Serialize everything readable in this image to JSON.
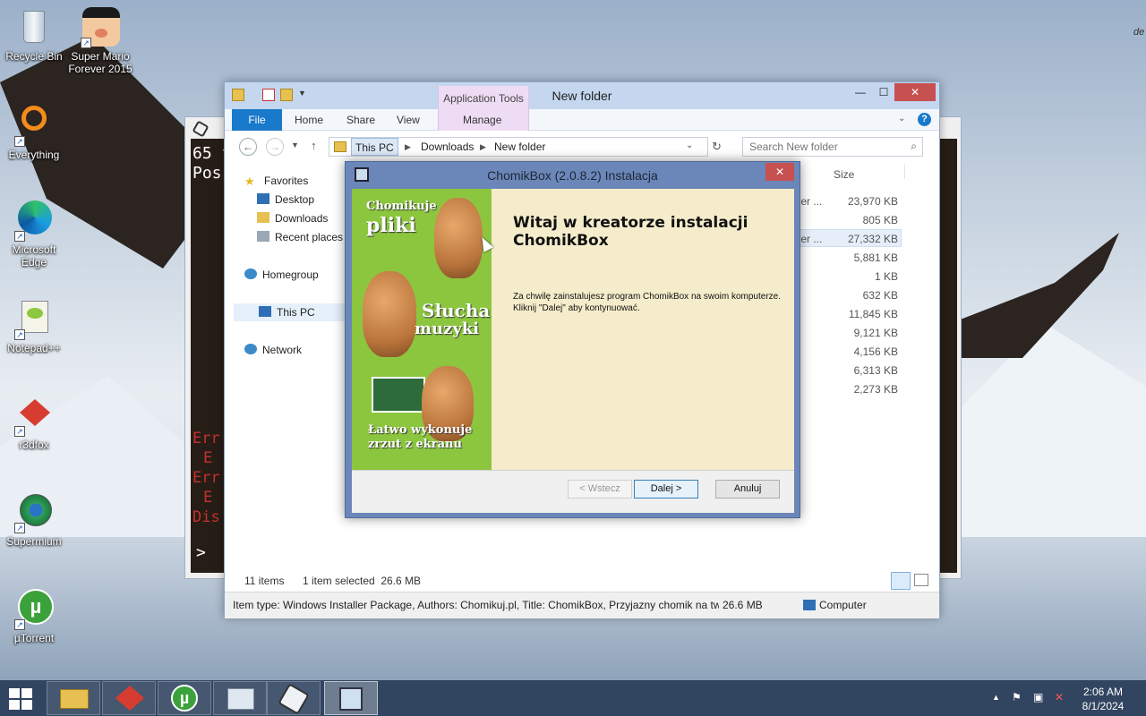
{
  "desktop": {
    "icons": [
      {
        "label": "Recycle Bin",
        "icon": "recycle-bin-icon"
      },
      {
        "label": "Super Mario Forever 2015",
        "icon": "mario-icon"
      },
      {
        "label": "Everything",
        "icon": "everything-icon"
      },
      {
        "label": "Microsoft Edge",
        "icon": "edge-icon"
      },
      {
        "label": "Notepad++",
        "icon": "notepad-plus-icon"
      },
      {
        "label": "r3dfox",
        "icon": "r3dfox-icon"
      },
      {
        "label": "Supermium",
        "icon": "supermium-icon"
      },
      {
        "label": "µTorrent",
        "icon": "utorrent-icon"
      }
    ],
    "corner_text": "de"
  },
  "console": {
    "lines_top": [
      "65 f",
      "Pos"
    ],
    "lines_error": [
      "Err",
      "E",
      "Err",
      "E",
      "Dis"
    ],
    "prompt": ">"
  },
  "explorer": {
    "title": "New folder",
    "context_tab": "Application Tools",
    "ribbon_tabs": [
      "File",
      "Home",
      "Share",
      "View"
    ],
    "context_subtab": "Manage",
    "breadcrumb": [
      "This PC",
      "Downloads",
      "New folder"
    ],
    "search_placeholder": "Search New folder",
    "nav": {
      "favorites": "Favorites",
      "desktop": "Desktop",
      "downloads": "Downloads",
      "recent": "Recent places",
      "homegroup": "Homegroup",
      "thispc": "This PC",
      "network": "Network"
    },
    "size_header": "Size",
    "name_fragments": [
      "ller ...",
      "ller ..."
    ],
    "sizes": [
      "23,970 KB",
      "805 KB",
      "27,332 KB",
      "5,881 KB",
      "1 KB",
      "632 KB",
      "11,845 KB",
      "9,121 KB",
      "4,156 KB",
      "6,313 KB",
      "2,273 KB"
    ],
    "status_items": "11 items",
    "status_selected": "1 item selected  26.6 MB",
    "info_text": "Item type: Windows Installer Package, Authors: Chomikuj.pl, Title: ChomikBox, Przyjazny chomik na tw",
    "info_size": "26.6 MB",
    "info_location": "Computer"
  },
  "installer": {
    "title": "ChomikBox (2.0.8.2) Instalacja",
    "heading_line1": "Witaj w kreatorze instalacji",
    "heading_line2": "ChomikBox",
    "body": "Za chwilę zainstalujesz program ChomikBox na swoim komputerze.  Kliknij \"Dalej\" aby kontynuować.",
    "side_texts": {
      "t1a": "Chomikuje",
      "t1b": "pliki",
      "t2a": "Słucha",
      "t2b": "muzyki",
      "t3a": "Łatwo wykonuje",
      "t3b": "zrzut z ekranu"
    },
    "buttons": {
      "back": "< Wstecz",
      "next": "Dalej >",
      "cancel": "Anuluj"
    }
  },
  "taskbar": {
    "clock_time": "2:06 AM",
    "clock_date": "8/1/2024"
  }
}
